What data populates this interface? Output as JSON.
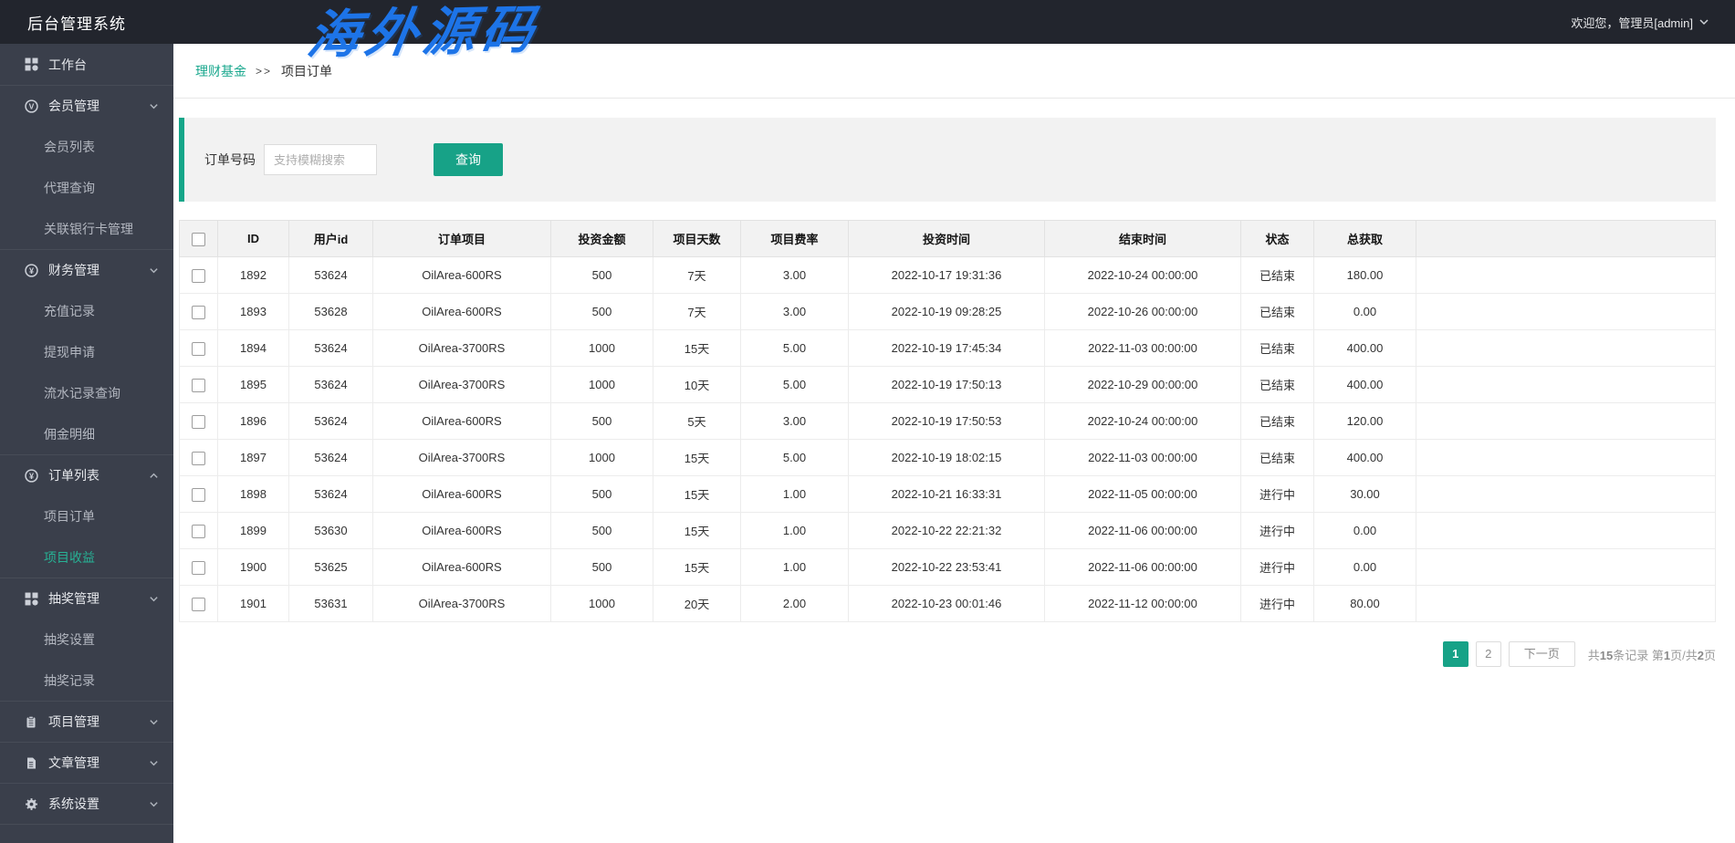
{
  "topbar": {
    "title": "后台管理系统",
    "welcome": "欢迎您，管理员[admin]",
    "watermark": "海外源码"
  },
  "breadcrumb": {
    "parent": "理财基金",
    "separator": ">>",
    "current": "项目订单"
  },
  "search": {
    "label": "订单号码",
    "placeholder": "支持模糊搜索",
    "button": "查询"
  },
  "sidebar": {
    "items": [
      {
        "id": "workbench",
        "label": "工作台",
        "type": "top",
        "icon": "dashboard-icon"
      },
      {
        "id": "member-mgmt",
        "label": "会员管理",
        "type": "group",
        "icon": "member-icon",
        "chevron": "down"
      },
      {
        "id": "member-list",
        "label": "会员列表",
        "type": "sub"
      },
      {
        "id": "agent-query",
        "label": "代理查询",
        "type": "sub"
      },
      {
        "id": "bank-cards",
        "label": "关联银行卡管理",
        "type": "sub"
      },
      {
        "id": "finance-mgmt",
        "label": "财务管理",
        "type": "group",
        "icon": "finance-icon",
        "chevron": "down"
      },
      {
        "id": "recharge-log",
        "label": "充值记录",
        "type": "sub"
      },
      {
        "id": "withdraw-req",
        "label": "提现申请",
        "type": "sub"
      },
      {
        "id": "flow-query",
        "label": "流水记录查询",
        "type": "sub"
      },
      {
        "id": "commission",
        "label": "佣金明细",
        "type": "sub"
      },
      {
        "id": "order-list",
        "label": "订单列表",
        "type": "group",
        "icon": "order-icon",
        "chevron": "up"
      },
      {
        "id": "project-order",
        "label": "项目订单",
        "type": "sub"
      },
      {
        "id": "project-income",
        "label": "项目收益",
        "type": "sub",
        "active": true
      },
      {
        "id": "lottery-mgmt",
        "label": "抽奖管理",
        "type": "group",
        "icon": "lottery-icon",
        "chevron": "down"
      },
      {
        "id": "lottery-set",
        "label": "抽奖设置",
        "type": "sub"
      },
      {
        "id": "lottery-log",
        "label": "抽奖记录",
        "type": "sub"
      },
      {
        "id": "project-mgmt",
        "label": "项目管理",
        "type": "group",
        "icon": "project-icon",
        "chevron": "down"
      },
      {
        "id": "article-mgmt",
        "label": "文章管理",
        "type": "group",
        "icon": "article-icon",
        "chevron": "down"
      },
      {
        "id": "system-set",
        "label": "系统设置",
        "type": "group",
        "icon": "settings-icon",
        "chevron": "down"
      }
    ]
  },
  "table": {
    "headers": [
      "ID",
      "用户id",
      "订单项目",
      "投资金额",
      "项目天数",
      "项目费率",
      "投资时间",
      "结束时间",
      "状态",
      "总获取"
    ],
    "rows": [
      [
        "1892",
        "53624",
        "OilArea-600RS",
        "500",
        "7天",
        "3.00",
        "2022-10-17 19:31:36",
        "2022-10-24 00:00:00",
        "已结束",
        "180.00"
      ],
      [
        "1893",
        "53628",
        "OilArea-600RS",
        "500",
        "7天",
        "3.00",
        "2022-10-19 09:28:25",
        "2022-10-26 00:00:00",
        "已结束",
        "0.00"
      ],
      [
        "1894",
        "53624",
        "OilArea-3700RS",
        "1000",
        "15天",
        "5.00",
        "2022-10-19 17:45:34",
        "2022-11-03 00:00:00",
        "已结束",
        "400.00"
      ],
      [
        "1895",
        "53624",
        "OilArea-3700RS",
        "1000",
        "10天",
        "5.00",
        "2022-10-19 17:50:13",
        "2022-10-29 00:00:00",
        "已结束",
        "400.00"
      ],
      [
        "1896",
        "53624",
        "OilArea-600RS",
        "500",
        "5天",
        "3.00",
        "2022-10-19 17:50:53",
        "2022-10-24 00:00:00",
        "已结束",
        "120.00"
      ],
      [
        "1897",
        "53624",
        "OilArea-3700RS",
        "1000",
        "15天",
        "5.00",
        "2022-10-19 18:02:15",
        "2022-11-03 00:00:00",
        "已结束",
        "400.00"
      ],
      [
        "1898",
        "53624",
        "OilArea-600RS",
        "500",
        "15天",
        "1.00",
        "2022-10-21 16:33:31",
        "2022-11-05 00:00:00",
        "进行中",
        "30.00"
      ],
      [
        "1899",
        "53630",
        "OilArea-600RS",
        "500",
        "15天",
        "1.00",
        "2022-10-22 22:21:32",
        "2022-11-06 00:00:00",
        "进行中",
        "0.00"
      ],
      [
        "1900",
        "53625",
        "OilArea-600RS",
        "500",
        "15天",
        "1.00",
        "2022-10-22 23:53:41",
        "2022-11-06 00:00:00",
        "进行中",
        "0.00"
      ],
      [
        "1901",
        "53631",
        "OilArea-3700RS",
        "1000",
        "20天",
        "2.00",
        "2022-10-23 00:01:46",
        "2022-11-12 00:00:00",
        "进行中",
        "80.00"
      ]
    ]
  },
  "pagination": {
    "pages": [
      "1",
      "2"
    ],
    "active_page": "1",
    "next_label": "下一页",
    "summary": {
      "records_prefix": "共",
      "records_count": "15",
      "records_suffix": "条记录 ",
      "page_prefix": "第",
      "page_current": "1",
      "page_middle": "页/共",
      "page_total": "2",
      "page_suffix": "页"
    }
  },
  "colors": {
    "accent_teal": "#17a287",
    "sidebar_active_teal": "#27b295",
    "breadcrumb_link_teal": "#1aa88e",
    "watermark_blue": "#1d74e8",
    "topbar_bg": "#22252d",
    "sidebar_bg": "#3a3f4b",
    "panel_bg": "#f2f2f2"
  }
}
